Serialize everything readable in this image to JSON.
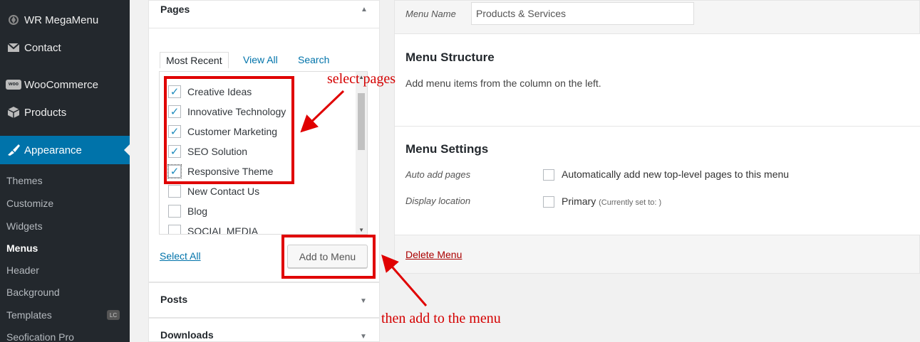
{
  "sidebar": {
    "items": [
      {
        "label": "WR MegaMenu",
        "icon": "megamenu-icon"
      },
      {
        "label": "Contact",
        "icon": "envelope-icon"
      },
      {
        "label": "WooCommerce",
        "icon": "woocommerce-icon"
      },
      {
        "label": "Products",
        "icon": "box-icon"
      },
      {
        "label": "Appearance",
        "icon": "brush-icon"
      }
    ],
    "submenu": [
      "Themes",
      "Customize",
      "Widgets",
      "Menus",
      "Header",
      "Background",
      "Templates",
      "Seofication Pro"
    ],
    "templates_badge": "LC",
    "woo_icon_text": "woo"
  },
  "pages_panel": {
    "title": "Pages",
    "tabs": [
      "Most Recent",
      "View All",
      "Search"
    ],
    "items": [
      {
        "label": "Creative Ideas",
        "checked": true
      },
      {
        "label": "Innovative Technology",
        "checked": true
      },
      {
        "label": "Customer Marketing",
        "checked": true
      },
      {
        "label": "SEO Solution",
        "checked": true
      },
      {
        "label": "Responsive Theme",
        "checked": true
      },
      {
        "label": "New Contact Us",
        "checked": false
      },
      {
        "label": "Blog",
        "checked": false
      },
      {
        "label": "SOCIAL MEDIA",
        "checked": false
      }
    ],
    "select_all": "Select All",
    "add_button": "Add to Menu"
  },
  "posts_panel": {
    "title": "Posts"
  },
  "downloads_panel": {
    "title": "Downloads"
  },
  "menu": {
    "name_label": "Menu Name",
    "name_value": "Products & Services",
    "structure_title": "Menu Structure",
    "structure_hint": "Add menu items from the column on the left.",
    "settings_title": "Menu Settings",
    "auto_add_label": "Auto add pages",
    "auto_add_text": "Automatically add new top-level pages to this menu",
    "display_location_label": "Display location",
    "primary_label": "Primary",
    "primary_note": "(Currently set to: )",
    "delete_label": "Delete Menu"
  },
  "annotations": {
    "select_pages": "select pages",
    "add_to_menu": "then add to the menu",
    "color": "#e00000"
  },
  "colors": {
    "sidebar_bg": "#23282d",
    "active_bg": "#0073aa",
    "link": "#0073aa",
    "delete": "#aa0000"
  }
}
